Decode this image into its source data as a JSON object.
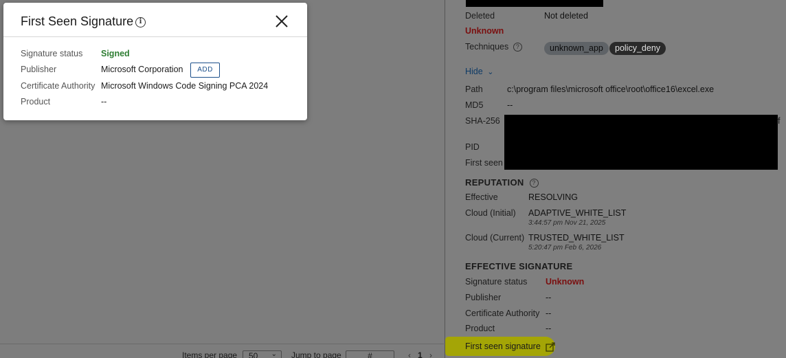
{
  "pager": {
    "items_per_page_label": "Items per page",
    "items_per_page_value": "50",
    "jump_to_page_label": "Jump to page",
    "jump_to_page_placeholder": "#",
    "current_page": "1"
  },
  "panel": {
    "deleted_label": "Deleted",
    "deleted_value": "Not deleted",
    "unknown_status": "Unknown",
    "techniques_label": "Techniques",
    "techniques": [
      "unknown_app",
      "policy_deny"
    ],
    "hide_link": "Hide",
    "path_label": "Path",
    "path_value": "c:\\program files\\microsoft office\\root\\office16\\excel.exe",
    "md5_label": "MD5",
    "md5_value": "--",
    "sha256_label": "SHA-256",
    "sha256_tail": "f",
    "pid_label": "PID",
    "first_seen_label": "First seen",
    "reputation": {
      "heading": "REPUTATION",
      "effective_label": "Effective",
      "effective_value": "RESOLVING",
      "cloud_initial_label": "Cloud (Initial)",
      "cloud_initial_value": "ADAPTIVE_WHITE_LIST",
      "cloud_initial_time": "3:44:57 pm Nov 21, 2025",
      "cloud_current_label": "Cloud (Current)",
      "cloud_current_value": "TRUSTED_WHITE_LIST",
      "cloud_current_time": "5:20:47 pm Feb 6, 2026"
    },
    "effective_signature": {
      "heading": "EFFECTIVE SIGNATURE",
      "status_label": "Signature status",
      "status_value": "Unknown",
      "publisher_label": "Publisher",
      "publisher_value": "--",
      "ca_label": "Certificate Authority",
      "ca_value": "--",
      "product_label": "Product",
      "product_value": "--"
    },
    "first_seen_signature_link": "First seen signature"
  },
  "modal": {
    "title": "First Seen Signature",
    "status_label": "Signature status",
    "status_value": "Signed",
    "publisher_label": "Publisher",
    "publisher_value": "Microsoft Corporation",
    "add_button": "ADD",
    "ca_label": "Certificate Authority",
    "ca_value": "Microsoft Windows Code Signing PCA 2024",
    "product_label": "Product",
    "product_value": "--"
  },
  "colors": {
    "signed_green": "#2e7d32",
    "unknown_red": "#7a0f0f",
    "highlight_yellow": "#a6a800",
    "add_button_blue": "#1b4f8a"
  }
}
